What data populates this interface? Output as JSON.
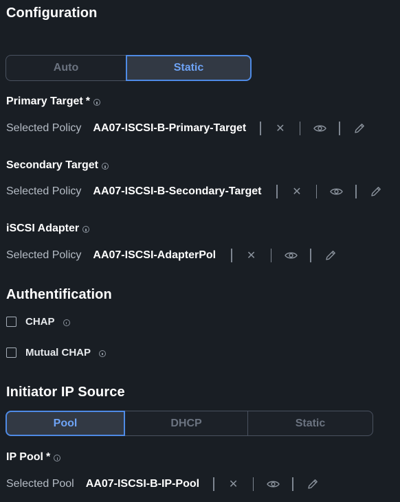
{
  "configuration": {
    "title": "Configuration",
    "mode_options": [
      "Auto",
      "Static"
    ],
    "selected_mode": "Static"
  },
  "primary_target": {
    "label": "Primary Target",
    "required_marker": "*",
    "selected_key": "Selected Policy",
    "value": "AA07-ISCSI-B-Primary-Target"
  },
  "secondary_target": {
    "label": "Secondary Target",
    "selected_key": "Selected Policy",
    "value": "AA07-ISCSI-B-Secondary-Target"
  },
  "iscsi_adapter": {
    "label": "iSCSI Adapter",
    "selected_key": "Selected Policy",
    "value": "AA07-ISCSI-AdapterPol"
  },
  "authentication": {
    "title": "Authentification",
    "options": [
      {
        "label": "CHAP",
        "checked": false
      },
      {
        "label": "Mutual CHAP",
        "checked": false
      }
    ]
  },
  "initiator_ip_source": {
    "title": "Initiator IP Source",
    "options": [
      "Pool",
      "DHCP",
      "Static"
    ],
    "selected": "Pool"
  },
  "ip_pool": {
    "label": "IP Pool",
    "required_marker": "*",
    "selected_key": "Selected Pool",
    "value": "AA07-ISCSI-B-IP-Pool"
  },
  "icons": {
    "clear": "close-icon",
    "view": "eye-icon",
    "edit": "pencil-icon",
    "info": "info-icon"
  },
  "colors": {
    "background": "#191e24",
    "accent": "#4f8be6",
    "active_text": "#6ea3f5",
    "inactive_text": "#6b7380"
  }
}
